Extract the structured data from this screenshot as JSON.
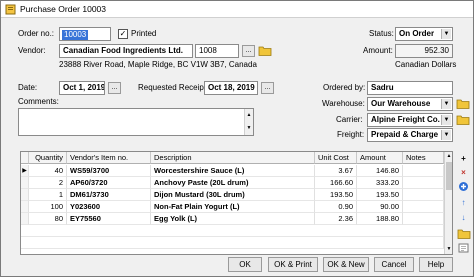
{
  "window": {
    "title": "Purchase Order 10003"
  },
  "header": {
    "order_no_label": "Order no.:",
    "order_no": "10003",
    "printed_label": "Printed",
    "printed_mark": "✓",
    "status_label": "Status:",
    "status": "On Order",
    "vendor_label": "Vendor:",
    "vendor_name": "Canadian Food Ingredients Ltd.",
    "vendor_code": "1008",
    "vendor_address": "23888 River Road, Maple Ridge, BC  V1W 3B7, Canada",
    "amount_label": "Amount:",
    "amount": "952.30",
    "currency": "Canadian Dollars",
    "date_label": "Date:",
    "date": "Oct 1, 2019",
    "requested_label": "Requested Receipt:",
    "requested": "Oct 18, 2019",
    "ordered_by_label": "Ordered by:",
    "ordered_by": "Sadru",
    "comments_label": "Comments:",
    "warehouse_label": "Warehouse:",
    "warehouse": "Our Warehouse",
    "carrier_label": "Carrier:",
    "carrier": "Alpine Freight Co.",
    "freight_label": "Freight:",
    "freight": "Prepaid & Charge",
    "ellipsis": "..."
  },
  "grid": {
    "columns": [
      "Quantity",
      "Vendor's Item no.",
      "Description",
      "Unit Cost",
      "Amount",
      "Notes"
    ],
    "rows": [
      {
        "qty": "40",
        "item": "WS59/3700",
        "desc": "Worcestershire Sauce (L)",
        "cost": "3.67",
        "amount": "146.80",
        "notes": ""
      },
      {
        "qty": "2",
        "item": "AP60/3720",
        "desc": "Anchovy Paste (20L drum)",
        "cost": "166.60",
        "amount": "333.20",
        "notes": ""
      },
      {
        "qty": "1",
        "item": "DM61/3730",
        "desc": "Dijon Mustard (30L drum)",
        "cost": "193.50",
        "amount": "193.50",
        "notes": ""
      },
      {
        "qty": "100",
        "item": "Y023600",
        "desc": "Non-Fat Plain Yogurt (L)",
        "cost": "0.90",
        "amount": "90.00",
        "notes": ""
      },
      {
        "qty": "80",
        "item": "EY75560",
        "desc": "Egg Yolk (L)",
        "cost": "2.36",
        "amount": "188.80",
        "notes": ""
      }
    ],
    "side_buttons": [
      "+",
      "×",
      "↑",
      "↓",
      "",
      ""
    ]
  },
  "footer": {
    "ok": "OK",
    "ok_print": "OK & Print",
    "ok_new": "OK & New",
    "cancel": "Cancel",
    "help": "Help"
  }
}
